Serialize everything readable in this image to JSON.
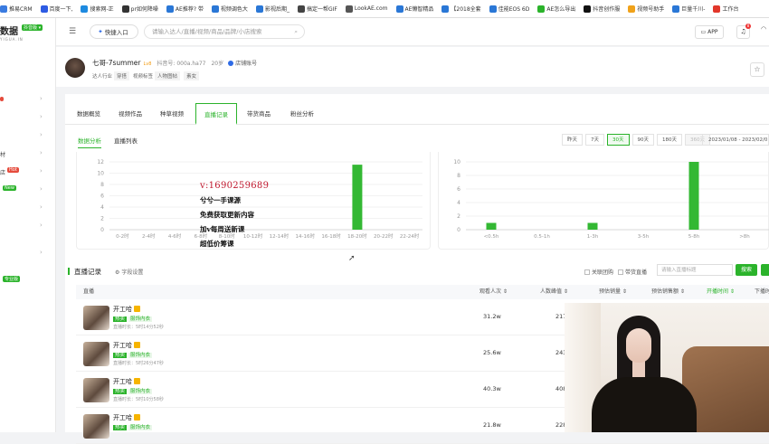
{
  "bookmarks": [
    {
      "label": "推易CRM",
      "color": "#3a7be0"
    },
    {
      "label": "百度一下,",
      "color": "#2d5be3"
    },
    {
      "label": "搜索网-正",
      "color": "#1d8ae0"
    },
    {
      "label": "pr如何降噪",
      "color": "#333333"
    },
    {
      "label": "AE推荐? 带",
      "color": "#2a77d6"
    },
    {
      "label": "视频调色大",
      "color": "#2a77d6"
    },
    {
      "label": "影视后期_",
      "color": "#2a77d6"
    },
    {
      "label": "搞定一帮GIF",
      "color": "#444444"
    },
    {
      "label": "LookAE.com",
      "color": "#555555"
    },
    {
      "label": "AE懒智精品",
      "color": "#2a77d6"
    },
    {
      "label": "【2018全套",
      "color": "#2a77d6"
    },
    {
      "label": "佳能EOS 6D",
      "color": "#2a77d6"
    },
    {
      "label": "AE怎么导出",
      "color": "#2bb32b"
    },
    {
      "label": "抖音创作服",
      "color": "#111111"
    },
    {
      "label": "视频号助手",
      "color": "#f0a21a"
    },
    {
      "label": "巨量千川-",
      "color": "#2a77d6"
    },
    {
      "label": "工作台",
      "color": "#e2372b"
    }
  ],
  "logo": {
    "text": "数据",
    "sub": "YIGUA.IN",
    "badge": "抖音版 ▾"
  },
  "sidebar": {
    "items": [
      {
        "label": "",
        "tag": "",
        "tag_color": ""
      },
      {
        "label": "",
        "tag": "",
        "tag_color": ""
      },
      {
        "label": "",
        "tag": "",
        "tag_color": ""
      },
      {
        "label": "材",
        "tag": "",
        "tag_color": ""
      },
      {
        "label": "店",
        "tag": "Hot",
        "tag_color": "#e54b3c"
      },
      {
        "label": "",
        "tag": "New",
        "tag_color": "#2bb32b"
      },
      {
        "label": "",
        "tag": "",
        "tag_color": ""
      },
      {
        "label": "",
        "tag": "",
        "tag_color": ""
      },
      {
        "label": "",
        "tag": "",
        "tag_color": ""
      }
    ],
    "footer_tag": "专业版"
  },
  "topbar": {
    "quick_entry": "快捷入口",
    "search_placeholder": "请输入达人/直播/视频/商品/品牌/小店搜索",
    "app_label": "APP",
    "notify_count": "8"
  },
  "profile": {
    "name": "七哥-7summer",
    "level": "Lv8",
    "douyin_id": "抖音号: 000a.ha77",
    "age": "20岁",
    "shop": "店铺账号",
    "industry_label": "达人行业",
    "industry": "穿搭",
    "video_tags_label": "视频标签",
    "tag1": "人物图帖",
    "tag2": "素女"
  },
  "tabs": [
    "数据概览",
    "视频作品",
    "种草视频",
    "直播记录",
    "带货商品",
    "粉丝分析"
  ],
  "active_tab": "直播记录",
  "subtabs": [
    "数据分析",
    "直播列表"
  ],
  "date_buttons": [
    "昨天",
    "7天",
    "30天",
    "90天",
    "180天",
    "360天"
  ],
  "date_active": "30天",
  "date_range": "2023/01/08 - 2023/02/0",
  "chart_data": [
    {
      "type": "bar",
      "categories": [
        "0-2时",
        "2-4时",
        "4-6时",
        "6-8时",
        "8-10时",
        "10-12时",
        "12-14时",
        "14-16时",
        "16-18时",
        "18-20时",
        "20-22时",
        "22-24时"
      ],
      "values": [
        0,
        0,
        0,
        0,
        0,
        0,
        0,
        0,
        0,
        11.5,
        0,
        0
      ],
      "ylim": [
        0,
        12
      ],
      "yticks": [
        "12",
        "10",
        "8",
        "6",
        "4",
        "2",
        "0"
      ],
      "grid": true,
      "color": "#33b833"
    },
    {
      "type": "bar",
      "categories": [
        "<0.5h",
        "0.5-1h",
        "1-3h",
        "3-5h",
        "5-8h",
        ">8h"
      ],
      "values": [
        1,
        0,
        1,
        0,
        10,
        0
      ],
      "ylim": [
        0,
        10
      ],
      "yticks": [
        "10",
        "8",
        "6",
        "4",
        "2",
        "0"
      ],
      "grid": true,
      "color": "#33b833"
    }
  ],
  "records": {
    "title": "直播记录",
    "field_settings": "字段设置",
    "check1": "关联团购",
    "check2": "带货直播",
    "search_placeholder": "请输入直播标题",
    "search_btn": "搜索",
    "columns": [
      "直播",
      "观看人次 ⇕",
      "人数峰值 ⇕",
      "预估销量 ⇕",
      "预估销售额 ⇕",
      "开播时间 ⇕",
      "下播时"
    ],
    "rows": [
      {
        "title": "开工哈",
        "hot": "热卖",
        "cat": "服饰内衣",
        "duration": "直播时长：5时14分52秒",
        "views": "31.2w",
        "peak": "217"
      },
      {
        "title": "开工哈",
        "hot": "热卖",
        "cat": "服饰内衣",
        "duration": "直播时长：5时26分47秒",
        "views": "25.6w",
        "peak": "243"
      },
      {
        "title": "开工哈",
        "hot": "热卖",
        "cat": "服饰内衣",
        "duration": "直播时长：5时10分58秒",
        "views": "40.3w",
        "peak": "408"
      },
      {
        "title": "开工哈",
        "hot": "热卖",
        "cat": "服饰内衣",
        "duration": "",
        "views": "21.8w",
        "peak": "228"
      }
    ]
  },
  "watermark": {
    "lines": [
      "v:1690259689",
      "兮兮一手课源",
      "免费获取更新内容",
      "加v每周送新课",
      "超低价筹课"
    ]
  }
}
